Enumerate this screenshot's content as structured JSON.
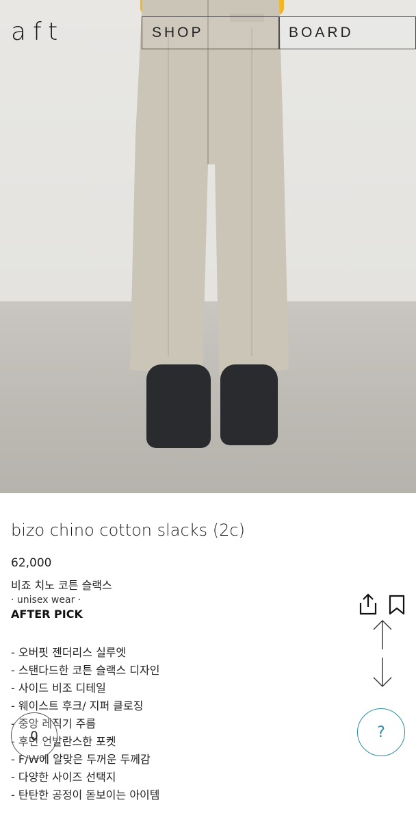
{
  "header": {
    "logo": "aft",
    "nav": [
      {
        "label": "SHOP"
      },
      {
        "label": "BOARD"
      }
    ]
  },
  "product": {
    "title": "bizo chino cotton slacks (2c)",
    "price": "62,000",
    "name_ko": "비죠 치노 코튼 슬랙스",
    "tagline": "· unisex wear ·",
    "pick": "AFTER PICK",
    "features": [
      "- 오버핏 젠더리스 실루엣",
      "- 스탠다드한 코튼 슬랙스 디자인",
      "- 사이드 비조 디테일",
      "- 웨이스트 후크/ 지퍼 클로징",
      "- 중앙 레직기 주름",
      "- 후면 언발란스한 포켓",
      "- F/W에 알맞은 두꺼운 두께감",
      "- 다양한 사이즈 선택지",
      "- 탄탄한 공정이 돋보이는 아이템"
    ]
  },
  "widgets": {
    "cart_count": "0",
    "help_label": "?"
  },
  "icons": [
    "share-icon",
    "bookmark-icon",
    "arrow-up-icon",
    "arrow-down-icon",
    "help-icon",
    "cart-icon"
  ],
  "colors": {
    "help_accent": "#2a8fa0",
    "shirt": "#f3b520",
    "pants": "#cbc5b8",
    "shoes": "#2a2b2e"
  }
}
